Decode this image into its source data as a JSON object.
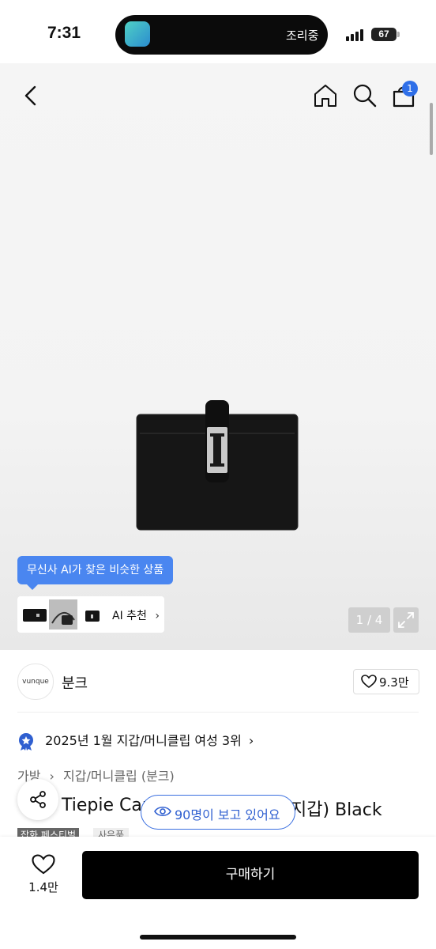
{
  "status_bar": {
    "time": "7:31",
    "activity_label": "조리중",
    "battery": "67"
  },
  "header": {
    "cart_count": "1",
    "icons": [
      "back-icon",
      "home-icon",
      "search-icon",
      "cart-icon"
    ]
  },
  "gallery": {
    "ai_tooltip": "무신사 AI가 찾은 비슷한 상품",
    "ai_recommend_label": "AI 추천",
    "pager": "1 / 4"
  },
  "brand": {
    "logo_text": "vunque",
    "name": "분크",
    "likes": "9.3만"
  },
  "product": {
    "ranking": "2025년 1월 지갑/머니클립 여성 3위",
    "breadcrumb": [
      "가방",
      "지갑/머니클립 (분크)"
    ],
    "title": "Tiepie Card w",
    "title_suffix": "지갑) Black",
    "viewers": "90명이 보고 있어요",
    "badges": [
      "잡화 페스티벌",
      "사은품"
    ]
  },
  "bottom_bar": {
    "like_count": "1.4만",
    "buy_label": "구매하기"
  },
  "colors": {
    "accent": "#2f6fe8",
    "buy_button": "#000000"
  }
}
